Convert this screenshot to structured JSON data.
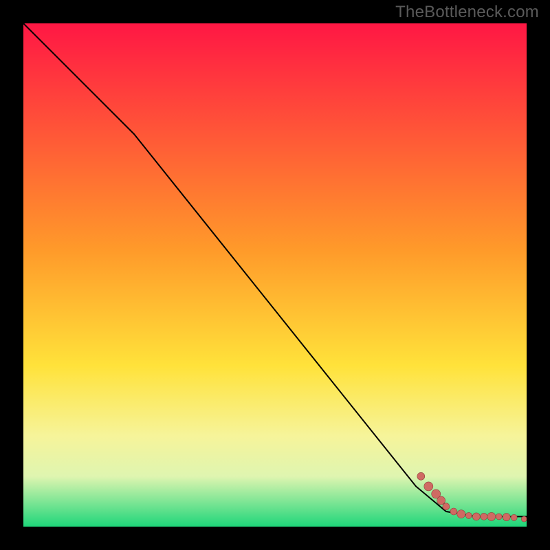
{
  "watermark": "TheBottleneck.com",
  "colors": {
    "accent_point": "#cf6a63",
    "accent_point_edge": "#903f3a",
    "curve": "#000000",
    "gradient": [
      {
        "offset": 0.0,
        "color": "#ff1744"
      },
      {
        "offset": 0.45,
        "color": "#ff9a2a"
      },
      {
        "offset": 0.68,
        "color": "#ffe23a"
      },
      {
        "offset": 0.82,
        "color": "#f6f49a"
      },
      {
        "offset": 0.9,
        "color": "#dff5b0"
      },
      {
        "offset": 1.0,
        "color": "#1fd67a"
      }
    ]
  },
  "chart_data": {
    "type": "line",
    "title": "",
    "xlabel": "",
    "ylabel": "",
    "xlim": [
      0,
      100
    ],
    "ylim": [
      0,
      100
    ],
    "series": [
      {
        "name": "curve",
        "kind": "line",
        "x": [
          0,
          10,
          22,
          78,
          84,
          90,
          100
        ],
        "y": [
          100,
          90,
          78,
          8,
          3,
          2,
          2
        ]
      },
      {
        "name": "data-points",
        "kind": "scatter",
        "points": [
          {
            "x": 79.0,
            "y": 10.0,
            "r": 5.5
          },
          {
            "x": 80.5,
            "y": 8.0,
            "r": 6.5
          },
          {
            "x": 82.0,
            "y": 6.5,
            "r": 6.5
          },
          {
            "x": 83.0,
            "y": 5.2,
            "r": 6.0
          },
          {
            "x": 84.0,
            "y": 4.0,
            "r": 5.0
          },
          {
            "x": 85.5,
            "y": 3.0,
            "r": 5.0
          },
          {
            "x": 87.0,
            "y": 2.5,
            "r": 6.0
          },
          {
            "x": 88.5,
            "y": 2.2,
            "r": 4.5
          },
          {
            "x": 90.0,
            "y": 2.0,
            "r": 5.5
          },
          {
            "x": 91.5,
            "y": 2.0,
            "r": 5.0
          },
          {
            "x": 93.0,
            "y": 2.0,
            "r": 6.0
          },
          {
            "x": 94.5,
            "y": 2.0,
            "r": 4.5
          },
          {
            "x": 96.0,
            "y": 1.9,
            "r": 5.5
          },
          {
            "x": 97.5,
            "y": 1.8,
            "r": 4.5
          },
          {
            "x": 99.5,
            "y": 1.5,
            "r": 4.0
          }
        ]
      }
    ],
    "grid": false,
    "legend": false
  }
}
